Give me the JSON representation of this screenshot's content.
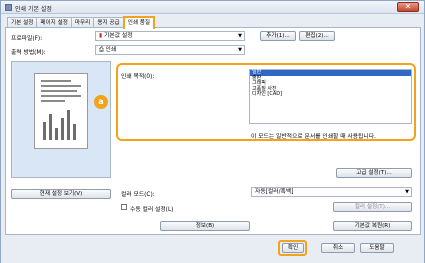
{
  "window": {
    "title": "인쇄 기본 설정",
    "close_glyph": "✕"
  },
  "tabs": [
    "기본 설정",
    "페이지 설정",
    "마무리",
    "용지 공급",
    "인쇄 품질"
  ],
  "active_tab": 4,
  "profile": {
    "label": "프로파일(F):",
    "value": "기본값 설정",
    "add_button": "추가(1)...",
    "edit_button": "편집(2)..."
  },
  "output_method": {
    "label": "출력 방법(M):",
    "value": "인쇄"
  },
  "print_purpose": {
    "label": "인쇄 목적(0):",
    "items": [
      "일반",
      "출판",
      "그래픽",
      "고품질 사진",
      "디자인 [CAD]"
    ],
    "selected_index": 0,
    "description": "이 모드는 일반적으로 문서를 인쇄할 때 사용됩니다."
  },
  "detail_button": "고급 설정(T)...",
  "preview_button": "현재 설정 보기(V)",
  "color_mode": {
    "label": "컬러 모드(C):",
    "value": "자동[컬러/흑백]"
  },
  "manual_color": {
    "label": "수동 컬러 설정(L)",
    "checked": false,
    "button": "컬러 설정(T)..."
  },
  "info_button": "정보(B)",
  "restore_button": "기본값 복원(R)",
  "dialog_buttons": {
    "ok": "확인",
    "cancel": "취소",
    "help": "도움말"
  },
  "badge_letter": "a",
  "accent_color": "#f2a31b",
  "selection_color": "#3168c6"
}
